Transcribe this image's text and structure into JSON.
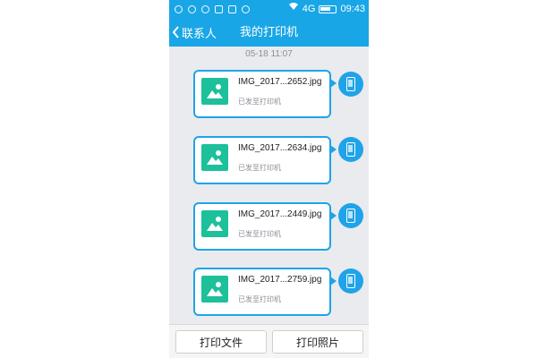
{
  "status_bar": {
    "network": "4G",
    "time": "09:43"
  },
  "nav": {
    "back_label": "联系人",
    "title": "我的打印机"
  },
  "timestamp": "05-18 11:07",
  "messages": [
    {
      "filename": "IMG_2017...2652.jpg",
      "status": "已发至打印机"
    },
    {
      "filename": "IMG_2017...2634.jpg",
      "status": "已发至打印机"
    },
    {
      "filename": "IMG_2017...2449.jpg",
      "status": "已发至打印机"
    },
    {
      "filename": "IMG_2017...2759.jpg",
      "status": "已发至打印机"
    }
  ],
  "bottom": {
    "print_file": "打印文件",
    "print_photo": "打印照片"
  },
  "colors": {
    "accent": "#19a6e6",
    "thumb": "#1cc09a",
    "background": "#e9ebee"
  },
  "icons": {
    "back": "chevron-left-icon",
    "image": "image-icon",
    "printer": "phone-icon"
  }
}
